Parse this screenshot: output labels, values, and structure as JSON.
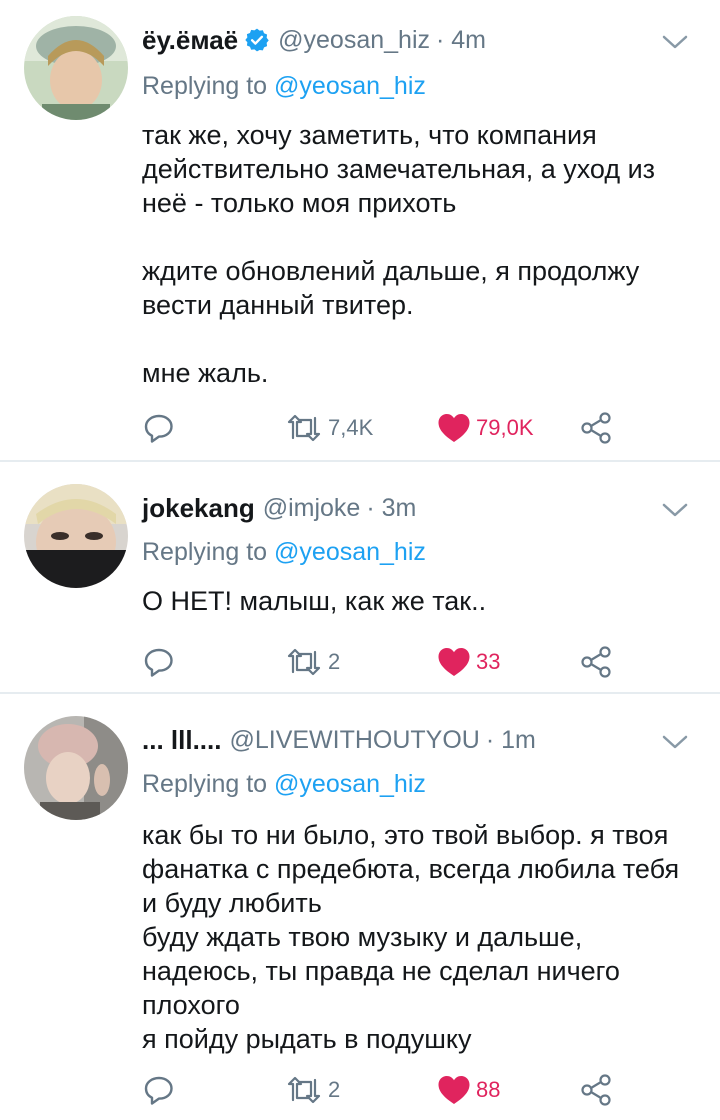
{
  "tweets": [
    {
      "name": "ёу.ёмаё",
      "verified": true,
      "handle": "@yeosan_hiz",
      "time": "· 4m",
      "reply_prefix": "Replying to",
      "reply_to": "@yeosan_hiz",
      "paragraphs": [
        "так же, хочу заметить, что компания действительно замечательная, а уход из неё - только моя прихоть",
        "ждите обновлений дальше, я продолжу вести данный твитер.",
        "мне жаль."
      ],
      "retweets": "7,4K",
      "likes": "79,0K"
    },
    {
      "name": "jokekang",
      "verified": false,
      "handle": "@imjoke",
      "time": "· 3m",
      "reply_prefix": "Replying to",
      "reply_to": "@yeosan_hiz",
      "paragraphs": [
        "О НЕТ! малыш, как же так.."
      ],
      "retweets": "2",
      "likes": "33"
    },
    {
      "name": "... lll....",
      "verified": false,
      "handle": "@LIVEWITHOUTYOU",
      "time": "· 1m",
      "reply_prefix": "Replying to",
      "reply_to": "@yeosan_hiz",
      "lines": [
        "как бы то ни было, это твой выбор. я твоя",
        "фанатка с предебюта, всегда любила тебя",
        "и буду любить",
        "буду ждать твою музыку и дальше,",
        "надеюсь, ты правда не сделал ничего",
        "плохого",
        "я пойду рыдать в подушку"
      ],
      "retweets": "2",
      "likes": "88"
    }
  ],
  "colors": {
    "accent": "#1da1f2",
    "like": "#e0245e",
    "muted": "#657786",
    "divider": "#e6ecf0"
  },
  "icons": [
    "reply-icon",
    "retweet-icon",
    "like-icon",
    "share-icon",
    "chevron-down-icon",
    "verified-badge-icon"
  ]
}
